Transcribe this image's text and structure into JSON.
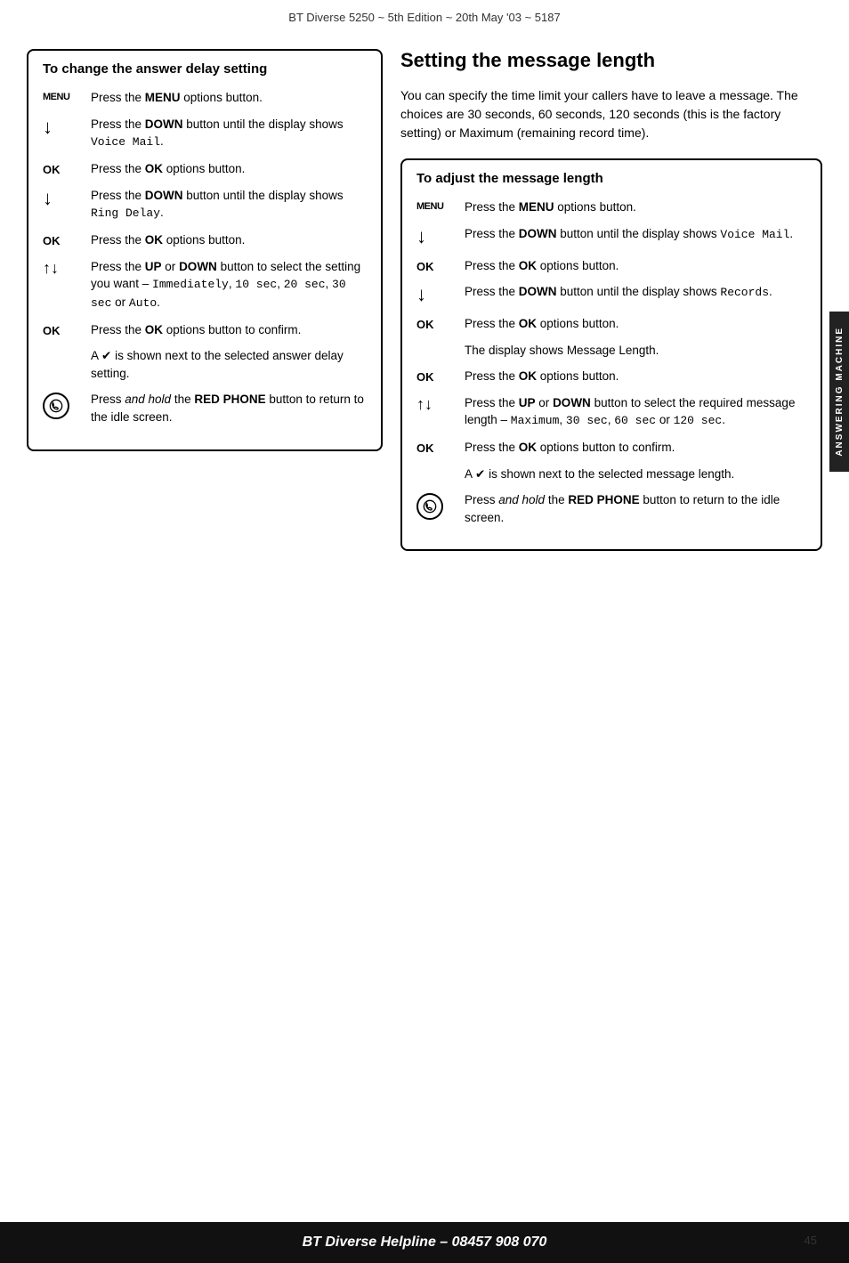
{
  "header": {
    "title": "BT Diverse 5250 ~ 5th Edition ~ 20th May '03 ~ 5187"
  },
  "left_box": {
    "title": "To change the answer delay setting",
    "steps": [
      {
        "icon_type": "menu",
        "icon_label": "MENU",
        "text": "Press the <b>MENU</b> options button."
      },
      {
        "icon_type": "down",
        "icon_label": "↓",
        "text": "Press the <b>DOWN</b> button until the display shows <span class='mono'>Voice Mail</span>."
      },
      {
        "icon_type": "ok",
        "icon_label": "OK",
        "text": "Press the <b>OK</b> options button."
      },
      {
        "icon_type": "down",
        "icon_label": "↓",
        "text": "Press the <b>DOWN</b> button until the display shows <span class='mono'>Ring Delay</span>."
      },
      {
        "icon_type": "ok",
        "icon_label": "OK",
        "text": "Press the <b>OK</b> options button."
      },
      {
        "icon_type": "updown",
        "icon_label": "↑↓",
        "text": "Press the <b>UP</b> or <b>DOWN</b> button to select the setting you want – <span class='mono'>Immediately</span>, <span class='mono'>10 sec</span>, <span class='mono'>20 sec</span>, <span class='mono'>30 sec</span> or <span class='mono'>Auto</span>."
      },
      {
        "icon_type": "ok",
        "icon_label": "OK",
        "text": "Press the <b>OK</b> options button to confirm."
      },
      {
        "icon_type": "note",
        "icon_label": "",
        "text": "A ✔ is shown next to the selected answer delay setting."
      },
      {
        "icon_type": "phone",
        "icon_label": "phone",
        "text": "Press <i>and hold</i> the <b>RED PHONE</b> button to return to the idle screen."
      }
    ]
  },
  "right_section": {
    "heading": "Setting the message length",
    "intro": "You can specify the time limit your callers have to leave a message. The choices are 30 seconds, 60 seconds, 120 seconds (this is the factory setting) or Maximum (remaining record time).",
    "box": {
      "title": "To adjust the message length",
      "steps": [
        {
          "icon_type": "menu",
          "icon_label": "MENU",
          "text": "Press the <b>MENU</b> options button."
        },
        {
          "icon_type": "down",
          "icon_label": "↓",
          "text": "Press the <b>DOWN</b> button until the display shows <span class='mono'>Voice Mail</span>."
        },
        {
          "icon_type": "ok",
          "icon_label": "OK",
          "text": "Press the <b>OK</b> options button."
        },
        {
          "icon_type": "down",
          "icon_label": "↓",
          "text": "Press the <b>DOWN</b> button until the display shows <span class='mono'>Records</span>."
        },
        {
          "icon_type": "ok",
          "icon_label": "OK",
          "text": "Press the <b>OK</b> options button."
        },
        {
          "icon_type": "note",
          "icon_label": "",
          "text": "The display shows <span class='mono'>Message Length</span>."
        },
        {
          "icon_type": "ok",
          "icon_label": "OK",
          "text": "Press the <b>OK</b> options button."
        },
        {
          "icon_type": "updown",
          "icon_label": "↑↓",
          "text": "Press the <b>UP</b> or <b>DOWN</b> button to select the required message length – <span class='mono'>Maximum</span>, <span class='mono'>30 sec</span>, <span class='mono'>60 sec</span> or <span class='mono'>120 sec</span>."
        },
        {
          "icon_type": "ok",
          "icon_label": "OK",
          "text": "Press the <b>OK</b> options button to confirm."
        },
        {
          "icon_type": "note",
          "icon_label": "",
          "text": "A ✔ is shown next to the selected message length."
        },
        {
          "icon_type": "phone",
          "icon_label": "phone",
          "text": "Press <i>and hold</i> the <b>RED PHONE</b> button to return to the idle screen."
        }
      ]
    }
  },
  "side_tab": {
    "label": "ANSWERING MACHINE"
  },
  "footer": {
    "text": "BT Diverse Helpline – 08457 908 070"
  },
  "page_number": "45"
}
